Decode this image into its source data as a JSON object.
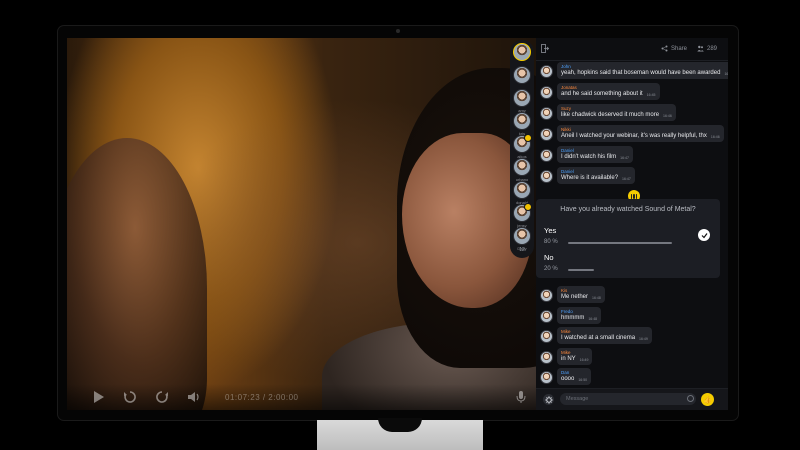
{
  "player": {
    "timecode": "01:07:23 / 2:00:00",
    "controls": [
      "play",
      "rewind",
      "forward",
      "volume"
    ]
  },
  "header": {
    "share_label": "Share",
    "viewer_count": "289"
  },
  "participants": [
    {
      "name": ""
    },
    {
      "name": ""
    },
    {
      "name": "amy"
    },
    {
      "name": "kris"
    },
    {
      "name": "aikos"
    },
    {
      "name": "urbano"
    },
    {
      "name": "donald"
    },
    {
      "name": "jensy"
    },
    {
      "name": "Dany"
    }
  ],
  "participants_more": "12",
  "messages_top": [
    {
      "name": "John",
      "name_color": "#4ea3ff",
      "text": "yeah, hopkins said that boseman would have been awarded",
      "time": "16:45"
    },
    {
      "name": "Jonatas",
      "name_color": "#ff8a3d",
      "text": "and he said something about it",
      "time": "16:45"
    },
    {
      "name": "Suzy",
      "name_color": "#ff8a3d",
      "text": "like chadwick deserved it much more",
      "time": "16:46"
    },
    {
      "name": "Nikki",
      "name_color": "#ff8a3d",
      "text": "Aneil I watched your webinar, it's was really helpful, thx",
      "time": "16:46"
    },
    {
      "name": "Daniel",
      "name_color": "#4ea3ff",
      "text": "I didn't watch his film",
      "time": "16:47"
    },
    {
      "name": "Daniel",
      "name_color": "#4ea3ff",
      "text": "Where is it available?",
      "time": "16:47"
    }
  ],
  "poll": {
    "question": "Have you already watched Sound of Metal?",
    "options": [
      {
        "label": "Yes",
        "percent_text": "80 %",
        "value": 0.8,
        "selected": true
      },
      {
        "label": "No",
        "percent_text": "20 %",
        "value": 0.2,
        "selected": false
      }
    ]
  },
  "messages_bottom": [
    {
      "name": "Kis",
      "name_color": "#ff8a3d",
      "text": "Me nether",
      "time": "16:48"
    },
    {
      "name": "Fredo",
      "name_color": "#4ea3ff",
      "text": "hmmmm",
      "time": "16:48"
    },
    {
      "name": "Mike",
      "name_color": "#ff8a3d",
      "text": "I watched at a small cinema",
      "time": "16:49"
    },
    {
      "name": "Mike",
      "name_color": "#ff8a3d",
      "text": "in NY",
      "time": "16:49"
    },
    {
      "name": "Dan",
      "name_color": "#4ea3ff",
      "text": "oooo",
      "time": "16:50"
    }
  ],
  "composer": {
    "placeholder": "Message"
  },
  "colors": {
    "accent": "#f5cc00",
    "panel_bg": "#0d0e11",
    "bubble_bg": "#24262c"
  }
}
